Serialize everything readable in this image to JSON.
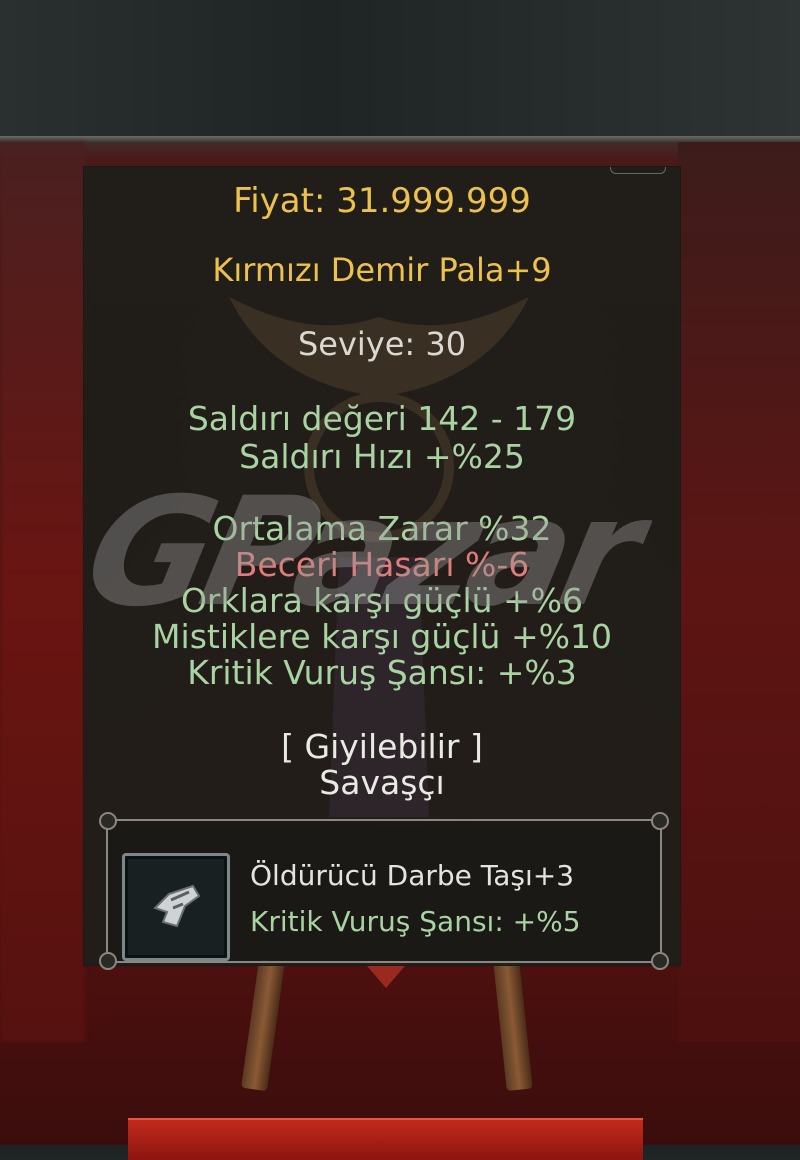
{
  "tooltip": {
    "price": "Fiyat: 31.999.999",
    "item_name": "Kırmızı Demir Pala+9",
    "level": "Seviye: 30",
    "attack_value": "Saldırı değeri 142 - 179",
    "attack_speed": "Saldırı Hızı +%25",
    "bonuses": [
      {
        "text": "Ortalama Zarar %32",
        "color": "#a9d3a3"
      },
      {
        "text": "Beceri Hasarı %-6",
        "color": "#e07c7c"
      },
      {
        "text": "Orklara karşı güçlü +%6",
        "color": "#a9d3a3"
      },
      {
        "text": "Mistiklere karşı güçlü +%10",
        "color": "#a9d3a3"
      },
      {
        "text": "Kritik Vuruş Şansı: +%3",
        "color": "#a9d3a3"
      }
    ],
    "wearable": "[ Giyilebilir ]",
    "class": "Savaşçı",
    "socket": {
      "icon": "stone-icon",
      "stone_name": "Öldürücü Darbe Taşı+3",
      "stone_stat": "Kritik Vuruş Şansı: +%5"
    }
  },
  "watermark": "GPazar",
  "colors": {
    "price_gold": "#ecc24d",
    "bonus_green": "#a9d3a3",
    "penalty_red": "#e07c7c"
  }
}
